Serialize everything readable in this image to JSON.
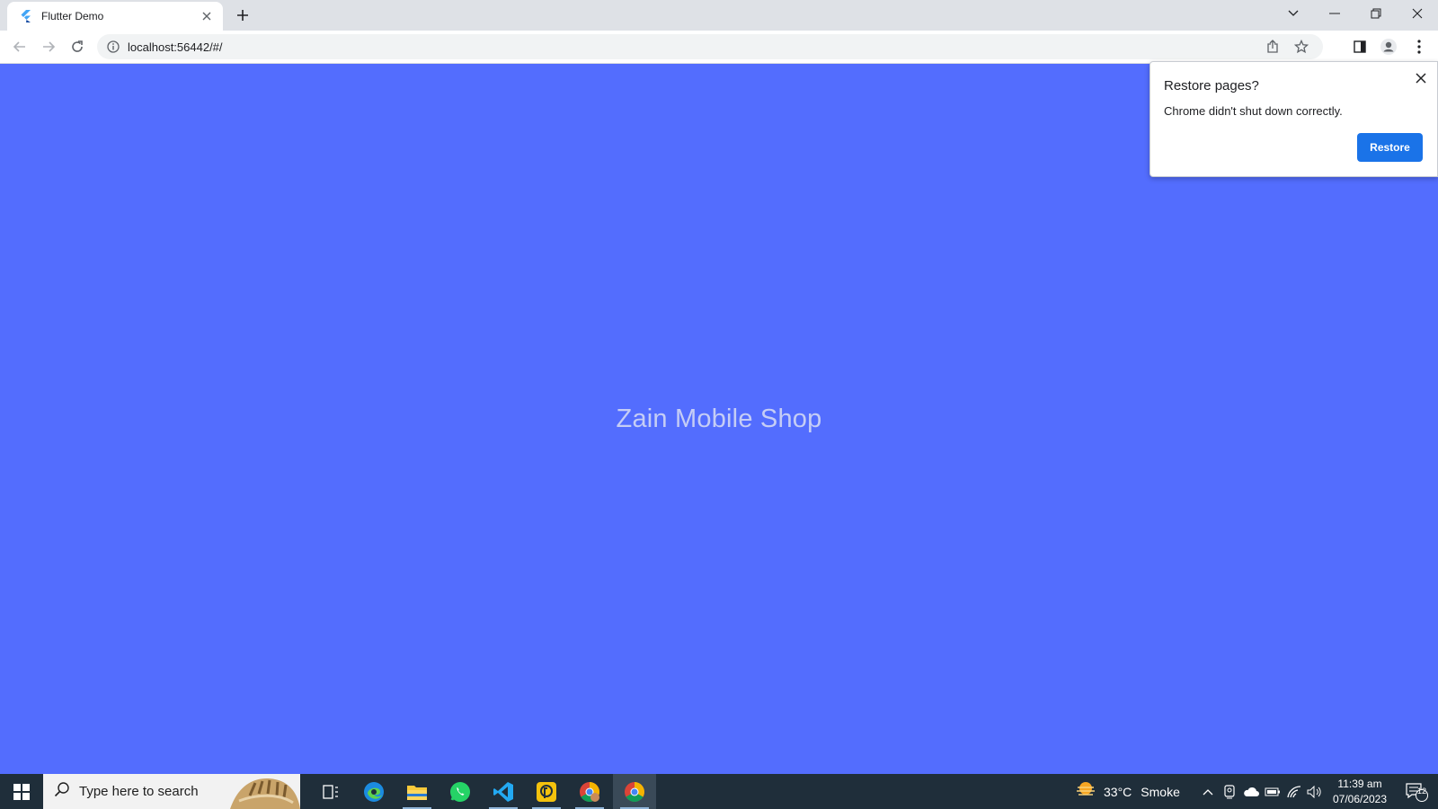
{
  "browser": {
    "tab_title": "Flutter Demo",
    "url": "localhost:56442/#/"
  },
  "page": {
    "title": "Zain Mobile Shop",
    "background": "#536dfe"
  },
  "restore_bubble": {
    "title": "Restore pages?",
    "message": "Chrome didn't shut down correctly.",
    "button_label": "Restore"
  },
  "taskbar": {
    "search_placeholder": "Type here to search",
    "weather_temp": "33°C",
    "weather_desc": "Smoke",
    "time": "11:39 am",
    "date": "07/06/2023",
    "notification_count": "12"
  }
}
